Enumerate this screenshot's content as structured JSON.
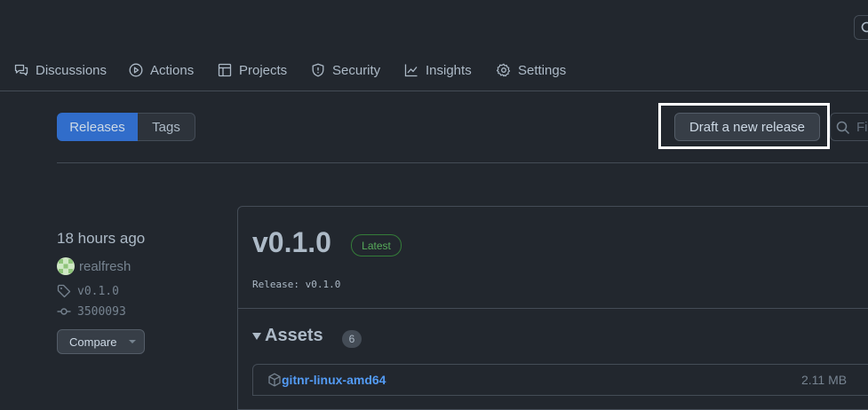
{
  "nav": {
    "tabs": [
      {
        "label": "Discussions",
        "icon": "comment-discussion-icon"
      },
      {
        "label": "Actions",
        "icon": "play-icon"
      },
      {
        "label": "Projects",
        "icon": "table-icon"
      },
      {
        "label": "Security",
        "icon": "shield-icon"
      },
      {
        "label": "Insights",
        "icon": "graph-icon"
      },
      {
        "label": "Settings",
        "icon": "gear-icon"
      }
    ]
  },
  "toolbar": {
    "releases_label": "Releases",
    "tags_label": "Tags",
    "draft_label": "Draft a new release",
    "filter_placeholder": "Fi"
  },
  "release": {
    "time": "18 hours ago",
    "author": "realfresh",
    "tag": "v0.1.0",
    "commit": "3500093",
    "compare_label": "Compare",
    "title": "v0.1.0",
    "badge": "Latest",
    "body": "Release: v0.1.0",
    "assets_label": "Assets",
    "assets_count": "6",
    "assets": [
      {
        "name": "gitnr-linux-amd64",
        "size": "2.11 MB"
      }
    ]
  },
  "colors": {
    "background": "#22272e",
    "primary": "#316dca",
    "link": "#539bf5",
    "success": "#57ab5a"
  }
}
